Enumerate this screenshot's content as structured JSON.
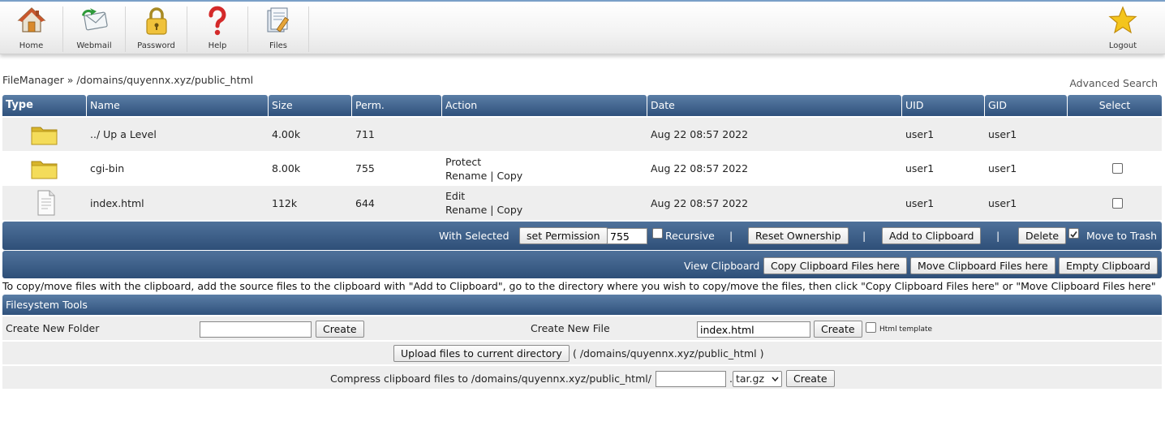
{
  "nav": {
    "items": [
      {
        "label": "Home",
        "icon": "house-icon"
      },
      {
        "label": "Webmail",
        "icon": "mail-icon"
      },
      {
        "label": "Password",
        "icon": "padlock-icon"
      },
      {
        "label": "Help",
        "icon": "question-icon"
      },
      {
        "label": "Files",
        "icon": "files-icon"
      }
    ],
    "logout": {
      "label": "Logout",
      "icon": "star-icon"
    }
  },
  "breadcrumb": {
    "root": "FileManager",
    "sep": "»",
    "path": "/domains/quyennx.xyz/public_html"
  },
  "advanced_search": "Advanced Search",
  "table": {
    "headers": {
      "type": "Type",
      "name": "Name",
      "size": "Size",
      "perm": "Perm.",
      "action": "Action",
      "date": "Date",
      "uid": "UID",
      "gid": "GID",
      "select": "Select"
    },
    "rows": [
      {
        "icon": "folder-icon",
        "name": "../ Up a Level",
        "size": "4.00k",
        "perm": "711",
        "action1": "",
        "action2": "",
        "action3": "",
        "date": "Aug 22 08:57 2022",
        "uid": "user1",
        "gid": "user1"
      },
      {
        "icon": "folder-icon",
        "name": "cgi-bin",
        "size": "8.00k",
        "perm": "755",
        "action1": "Protect",
        "action2": "Rename",
        "action3": "Copy",
        "date": "Aug 22 08:57 2022",
        "uid": "user1",
        "gid": "user1"
      },
      {
        "icon": "document-icon",
        "name": "index.html",
        "size": "112k",
        "perm": "644",
        "action1": "Edit",
        "action2": "Rename",
        "action3": "Copy",
        "date": "Aug 22 08:57 2022",
        "uid": "user1",
        "gid": "user1"
      }
    ],
    "action_sep": "|"
  },
  "with_selected": {
    "label": "With Selected",
    "set_permission": "set Permission",
    "permission_value": "755",
    "recursive": "Recursive",
    "sep": "|",
    "reset_ownership": "Reset Ownership",
    "add_clipboard": "Add to Clipboard",
    "delete": "Delete",
    "move_to_trash": "Move to Trash"
  },
  "clipboard": {
    "view": "View Clipboard",
    "copy_here": "Copy Clipboard Files here",
    "move_here": "Move Clipboard Files here",
    "empty": "Empty Clipboard",
    "note": "To copy/move files with the clipboard, add the source files to the clipboard with \"Add to Clipboard\", go to the directory where you wish to copy/move the files, then click \"Copy Clipboard Files here\" or \"Move Clipboard Files here\""
  },
  "fs_tools": {
    "title": "Filesystem Tools",
    "new_folder_label": "Create New Folder",
    "new_folder_value": "",
    "create": "Create",
    "new_file_label": "Create New File",
    "new_file_value": "index.html",
    "html_template": "Html template",
    "upload": "Upload files to current directory",
    "upload_path": "( /domains/quyennx.xyz/public_html )",
    "compress_label": "Compress clipboard files to /domains/quyennx.xyz/public_html/",
    "compress_value": "",
    "compress_dot": ".",
    "compress_ext": "tar.gz"
  }
}
